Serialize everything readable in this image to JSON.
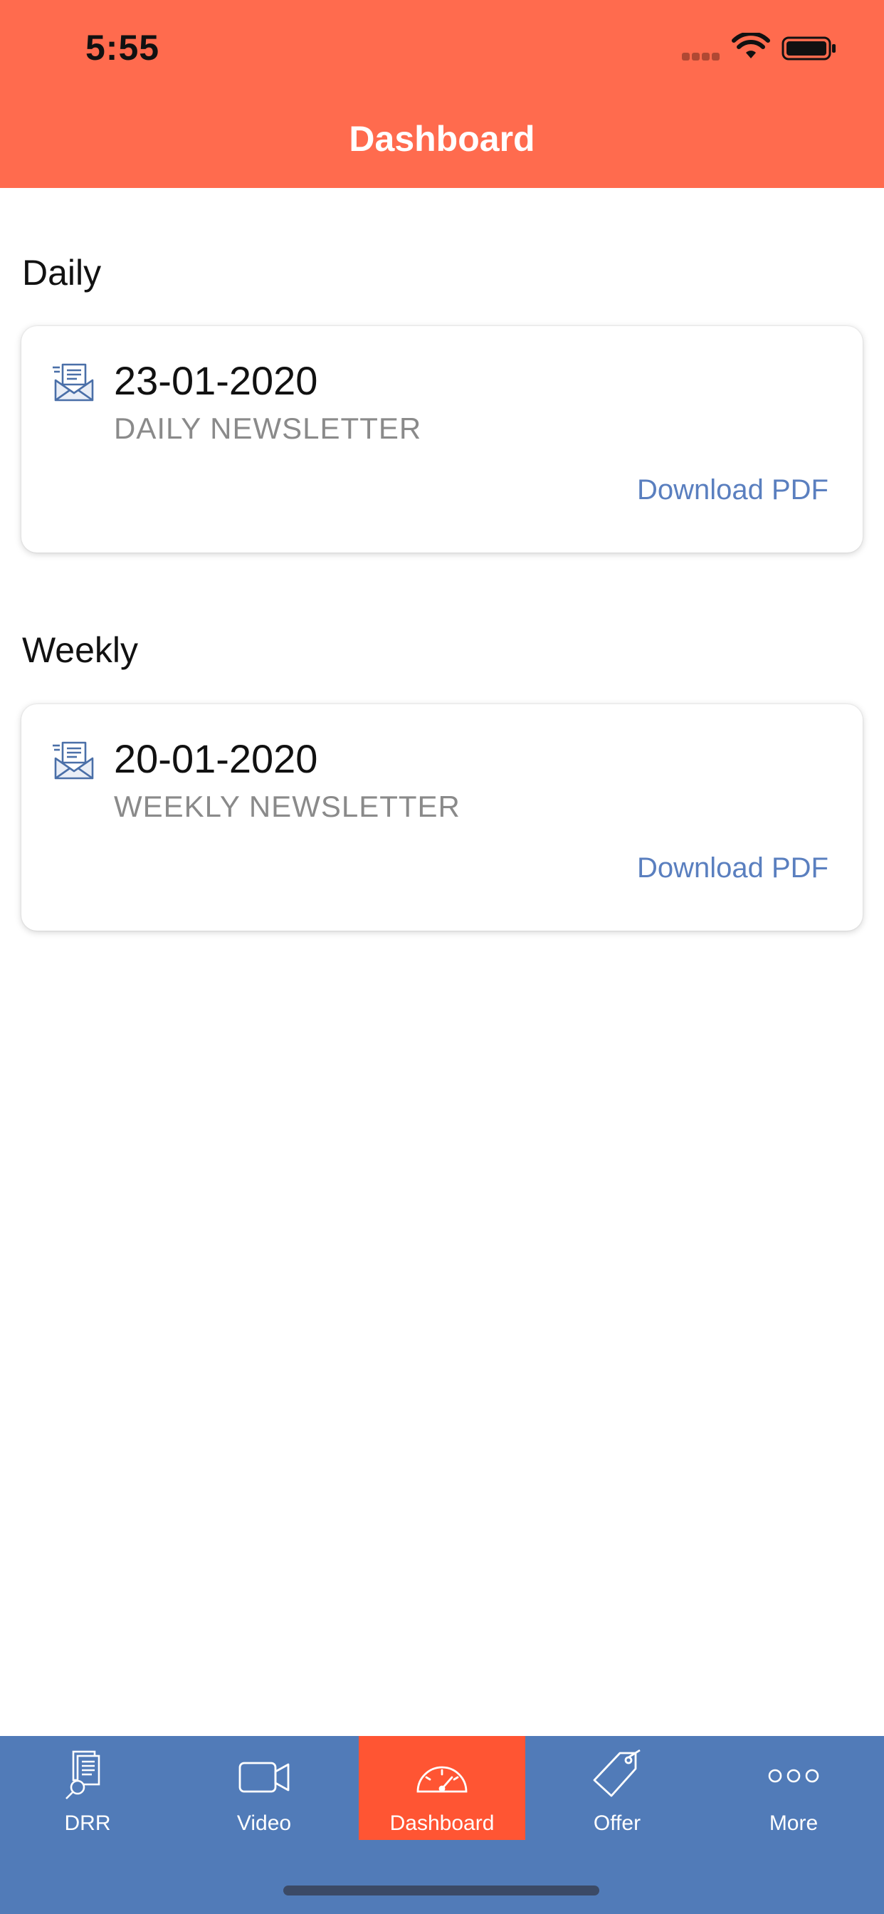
{
  "status_bar": {
    "time": "5:55"
  },
  "header": {
    "title": "Dashboard"
  },
  "sections": [
    {
      "title": "Daily",
      "card": {
        "date": "23-01-2020",
        "subtitle": "DAILY NEWSLETTER",
        "action_label": "Download PDF",
        "icon": "newsletter-icon"
      }
    },
    {
      "title": "Weekly",
      "card": {
        "date": "20-01-2020",
        "subtitle": "WEEKLY NEWSLETTER",
        "action_label": "Download PDF",
        "icon": "newsletter-icon"
      }
    }
  ],
  "tabbar": {
    "items": [
      {
        "label": "DRR",
        "icon": "document-search-icon"
      },
      {
        "label": "Video",
        "icon": "video-camera-icon"
      },
      {
        "label": "Dashboard",
        "icon": "speedometer-icon",
        "active": true
      },
      {
        "label": "Offer",
        "icon": "tag-icon"
      },
      {
        "label": "More",
        "icon": "more-dots-icon"
      }
    ]
  },
  "colors": {
    "header": "#FF6B4E",
    "tabbar": "#517BB8",
    "tab_active": "#FF5533",
    "link": "#5A7FBF"
  }
}
